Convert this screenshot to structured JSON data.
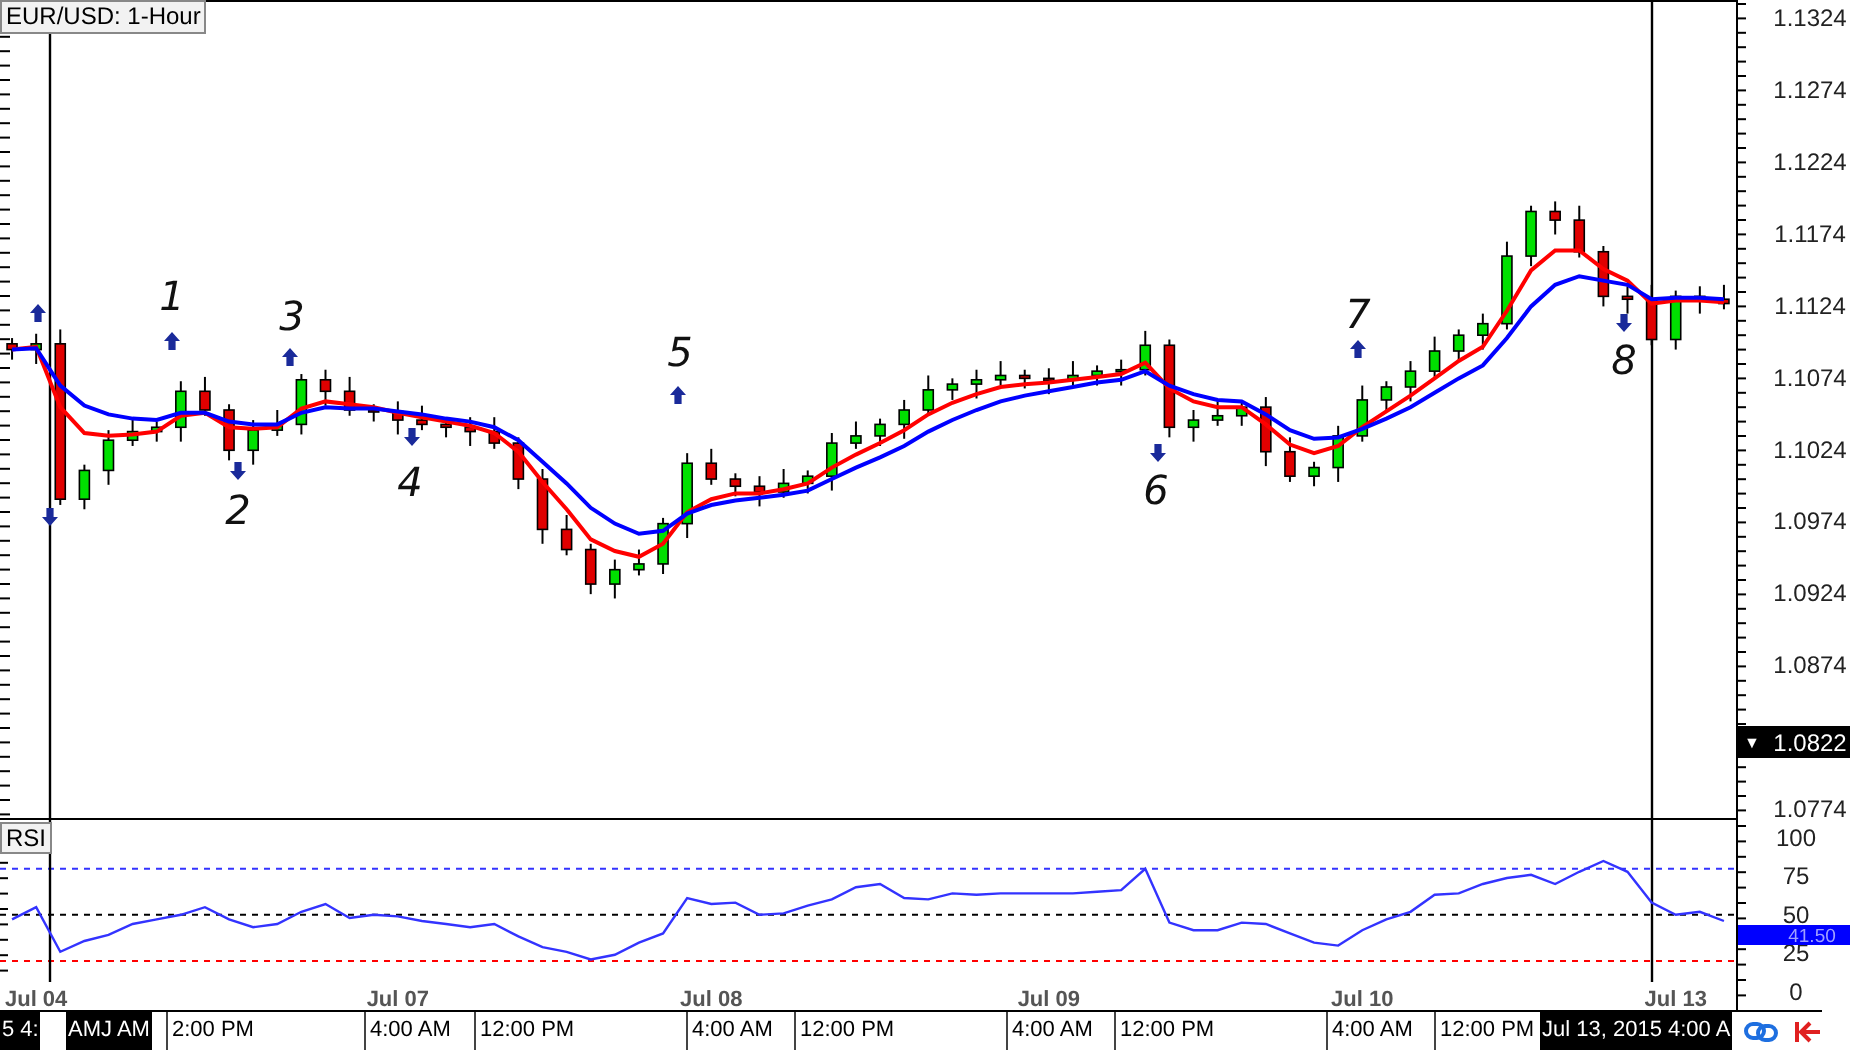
{
  "price_panel": {
    "chart_data": {
      "type": "candlestick",
      "title": "EUR/USD: 1-Hour",
      "ylim": [
        1.0768,
        1.1338
      ],
      "yticks": [
        1.1324,
        1.1274,
        1.1224,
        1.1174,
        1.1124,
        1.1074,
        1.1024,
        1.0974,
        1.0924,
        1.0874,
        1.0774
      ],
      "categories": [
        null,
        null,
        null,
        null,
        null,
        null,
        null,
        null,
        null,
        null,
        null,
        null,
        null,
        null,
        null,
        null,
        null,
        null,
        null,
        null,
        null,
        null,
        null,
        null,
        null,
        null,
        null,
        null,
        null,
        null,
        null,
        null,
        null,
        null,
        null,
        null,
        null,
        null,
        null,
        null,
        null,
        null,
        null,
        null,
        null,
        null,
        null,
        null,
        null,
        null,
        null,
        null,
        null,
        null,
        null,
        null,
        null,
        null,
        null,
        null,
        null,
        null,
        null,
        null,
        null,
        null,
        null,
        null,
        null,
        null,
        null,
        null
      ],
      "ohlc": [
        [
          1.1099,
          1.1103,
          1.1088,
          1.1095
        ],
        [
          1.1095,
          1.1106,
          1.1085,
          1.1099
        ],
        [
          1.1099,
          1.1109,
          1.0987,
          1.0991
        ],
        [
          1.0991,
          1.1015,
          1.0984,
          1.1011
        ],
        [
          1.1011,
          1.1039,
          1.1001,
          1.1032
        ],
        [
          1.1032,
          1.1048,
          1.1028,
          1.1038
        ],
        [
          1.1038,
          1.1045,
          1.1031,
          1.1041
        ],
        [
          1.1041,
          1.1073,
          1.1031,
          1.1066
        ],
        [
          1.1066,
          1.1076,
          1.1049,
          1.1053
        ],
        [
          1.1053,
          1.1057,
          1.1018,
          1.1025
        ],
        [
          1.1025,
          1.1046,
          1.1015,
          1.1039
        ],
        [
          1.1039,
          1.1053,
          1.1035,
          1.1043
        ],
        [
          1.1043,
          1.1078,
          1.1036,
          1.1074
        ],
        [
          1.1074,
          1.1081,
          1.1056,
          1.1066
        ],
        [
          1.1066,
          1.1076,
          1.1049,
          1.1053
        ],
        [
          1.1053,
          1.1057,
          1.1045,
          1.1052
        ],
        [
          1.1052,
          1.1059,
          1.1036,
          1.1046
        ],
        [
          1.1046,
          1.1056,
          1.1039,
          1.1043
        ],
        [
          1.1043,
          1.1047,
          1.1034,
          1.1041
        ],
        [
          1.1041,
          1.1048,
          1.1028,
          1.1038
        ],
        [
          1.1038,
          1.1048,
          1.1026,
          1.103
        ],
        [
          1.103,
          1.1034,
          1.0998,
          1.1005
        ],
        [
          1.1005,
          1.1012,
          1.096,
          1.097
        ],
        [
          1.097,
          1.098,
          1.0952,
          1.0956
        ],
        [
          1.0956,
          1.096,
          1.0925,
          1.0932
        ],
        [
          1.0932,
          1.0949,
          1.0922,
          1.0942
        ],
        [
          1.0942,
          1.0956,
          1.0938,
          1.0946
        ],
        [
          1.0946,
          1.0978,
          1.0939,
          1.0974
        ],
        [
          1.0974,
          1.1023,
          1.0964,
          1.1016
        ],
        [
          1.1016,
          1.1026,
          1.1001,
          1.1005
        ],
        [
          1.1005,
          1.1009,
          1.0993,
          1.1
        ],
        [
          1.1,
          1.1007,
          1.0986,
          1.0996
        ],
        [
          1.0996,
          1.1012,
          1.0992,
          1.1002
        ],
        [
          1.1002,
          1.1011,
          1.0995,
          1.1007
        ],
        [
          1.1007,
          1.1037,
          1.0997,
          1.103
        ],
        [
          1.103,
          1.1045,
          1.1026,
          1.1035
        ],
        [
          1.1035,
          1.1047,
          1.1028,
          1.1043
        ],
        [
          1.1043,
          1.106,
          1.1033,
          1.1053
        ],
        [
          1.1053,
          1.1077,
          1.1049,
          1.1067
        ],
        [
          1.1067,
          1.1075,
          1.106,
          1.1071
        ],
        [
          1.1071,
          1.1081,
          1.1061,
          1.1074
        ],
        [
          1.1074,
          1.1087,
          1.107,
          1.1077
        ],
        [
          1.1077,
          1.1081,
          1.1068,
          1.1075
        ],
        [
          1.1075,
          1.1082,
          1.1064,
          1.1074
        ],
        [
          1.1074,
          1.1087,
          1.107,
          1.1077
        ],
        [
          1.1077,
          1.1084,
          1.107,
          1.108
        ],
        [
          1.108,
          1.1088,
          1.107,
          1.1081
        ],
        [
          1.1081,
          1.1108,
          1.1077,
          1.1098
        ],
        [
          1.1098,
          1.1102,
          1.1034,
          1.1041
        ],
        [
          1.1041,
          1.1053,
          1.1031,
          1.1046
        ],
        [
          1.1046,
          1.1059,
          1.1042,
          1.1049
        ],
        [
          1.1049,
          1.1059,
          1.1042,
          1.1055
        ],
        [
          1.1055,
          1.1062,
          1.1014,
          1.1024
        ],
        [
          1.1024,
          1.1034,
          1.1003,
          1.1007
        ],
        [
          1.1007,
          1.1017,
          1.1,
          1.1013
        ],
        [
          1.1013,
          1.1042,
          1.1003,
          1.1035
        ],
        [
          1.1035,
          1.107,
          1.1031,
          1.106
        ],
        [
          1.106,
          1.1073,
          1.1053,
          1.1069
        ],
        [
          1.1069,
          1.1087,
          1.1059,
          1.108
        ],
        [
          1.108,
          1.1104,
          1.1076,
          1.1094
        ],
        [
          1.1094,
          1.1109,
          1.1087,
          1.1105
        ],
        [
          1.1105,
          1.112,
          1.1095,
          1.1113
        ],
        [
          1.1113,
          1.117,
          1.1109,
          1.116
        ],
        [
          1.116,
          1.1195,
          1.1153,
          1.1191
        ],
        [
          1.1191,
          1.1198,
          1.1175,
          1.1185
        ],
        [
          1.1185,
          1.1195,
          1.1159,
          1.1163
        ],
        [
          1.1163,
          1.1167,
          1.1125,
          1.1132
        ],
        [
          1.1132,
          1.1139,
          1.112,
          1.113
        ],
        [
          1.113,
          1.114,
          1.1098,
          1.1102
        ],
        [
          1.1102,
          1.1136,
          1.1095,
          1.1132
        ],
        [
          1.1132,
          1.1139,
          1.112,
          1.113
        ],
        [
          1.113,
          1.114,
          1.1123,
          1.1127
        ]
      ],
      "series": [
        {
          "type": "line",
          "color": "#ff0000",
          "values": [
            1.1095,
            1.1097,
            1.1055,
            1.1037,
            1.1035,
            1.1036,
            1.1038,
            1.1049,
            1.1051,
            1.1041,
            1.104,
            1.1041,
            1.1054,
            1.1059,
            1.1057,
            1.1055,
            1.1051,
            1.1048,
            1.1045,
            1.1042,
            1.1037,
            1.1024,
            1.1003,
            1.0984,
            1.0963,
            1.0955,
            1.0951,
            1.096,
            1.0982,
            1.0991,
            1.0995,
            1.0995,
            1.0998,
            1.1002,
            1.1013,
            1.1022,
            1.103,
            1.1039,
            1.105,
            1.1058,
            1.1064,
            1.1069,
            1.1071,
            1.1072,
            1.1074,
            1.1076,
            1.1078,
            1.1086,
            1.1068,
            1.1059,
            1.1055,
            1.1055,
            1.1043,
            1.1029,
            1.1023,
            1.1028,
            1.1041,
            1.1052,
            1.1063,
            1.1075,
            1.1087,
            1.1097,
            1.1122,
            1.115,
            1.1164,
            1.1164,
            1.1151,
            1.1143,
            1.1127,
            1.1129,
            1.1129,
            1.1128
          ]
        },
        {
          "type": "line",
          "color": "#0000ff",
          "values": [
            1.1095,
            1.1096,
            1.107,
            1.1056,
            1.105,
            1.1047,
            1.1046,
            1.1051,
            1.1051,
            1.1045,
            1.1043,
            1.1043,
            1.1051,
            1.1055,
            1.1054,
            1.1054,
            1.1052,
            1.105,
            1.1047,
            1.1045,
            1.1041,
            1.1032,
            1.1017,
            1.1002,
            1.0985,
            1.0974,
            1.0967,
            1.0969,
            1.0981,
            1.0987,
            1.099,
            1.0992,
            1.0994,
            1.0997,
            1.1005,
            1.1013,
            1.102,
            1.1028,
            1.1038,
            1.1046,
            1.1053,
            1.1059,
            1.1063,
            1.1066,
            1.1069,
            1.1072,
            1.1074,
            1.108,
            1.107,
            1.1064,
            1.106,
            1.1059,
            1.105,
            1.1039,
            1.1033,
            1.1034,
            1.104,
            1.1047,
            1.1055,
            1.1065,
            1.1075,
            1.1084,
            1.1103,
            1.1125,
            1.114,
            1.1146,
            1.1143,
            1.114,
            1.113,
            1.1131,
            1.1131,
            1.113
          ]
        }
      ],
      "annotations": [
        "1",
        "2",
        "3",
        "4",
        "5",
        "6",
        "7",
        "8"
      ]
    },
    "price_tag": {
      "marker": "▼",
      "text": "1.0822"
    }
  },
  "rsi_panel": {
    "chart_data": {
      "type": "line",
      "title": "RSI",
      "ylim": [
        -10.2,
        110.2
      ],
      "yticks": [
        100,
        75,
        50,
        25,
        0
      ],
      "categories": [
        null,
        "Jul 04",
        null,
        null,
        null,
        null,
        null,
        null,
        null,
        null,
        null,
        null,
        null,
        null,
        null,
        null,
        "Jul 07",
        null,
        null,
        null,
        null,
        null,
        null,
        null,
        null,
        null,
        null,
        null,
        null,
        "Jul 08",
        null,
        null,
        null,
        null,
        null,
        null,
        null,
        null,
        null,
        null,
        null,
        null,
        null,
        "Jul 09",
        null,
        null,
        null,
        null,
        null,
        null,
        null,
        null,
        null,
        null,
        null,
        null,
        "Jul 10",
        null,
        null,
        null,
        null,
        null,
        null,
        null,
        null,
        null,
        null,
        null,
        null,
        "Jul 13",
        null,
        null
      ],
      "series": [
        {
          "color": "#3333ff",
          "values": [
            47,
            55,
            26,
            33,
            37,
            44,
            47,
            50,
            55,
            47,
            42,
            44,
            52,
            57,
            48,
            50,
            49,
            46,
            44,
            42,
            44,
            36,
            29,
            26,
            21,
            24,
            32,
            38,
            61,
            57,
            58,
            50,
            51,
            56,
            60,
            68,
            70,
            61,
            60,
            64,
            63,
            64,
            64,
            64,
            64,
            65,
            66,
            80,
            45,
            40,
            40,
            45,
            44,
            38,
            32,
            30,
            40,
            47,
            52,
            63,
            64,
            70,
            74,
            76,
            70,
            78,
            85,
            78,
            58,
            50,
            52,
            46
          ]
        }
      ],
      "ref_lines": [
        {
          "axis": "y",
          "value": 80,
          "color": "#3333ff"
        },
        {
          "axis": "y",
          "value": 50,
          "color": "#000000"
        },
        {
          "axis": "y",
          "value": 20,
          "color": "#ff0000"
        }
      ]
    },
    "value_tag": {
      "text": "41.50"
    }
  },
  "time_bar": [
    {
      "text": "5 4:",
      "highlighted": true
    },
    {
      "text": "AMJ AM",
      "highlighted": true
    },
    {
      "text": "2:00 PM",
      "highlighted": false
    },
    {
      "text": "4:00 AM",
      "highlighted": false
    },
    {
      "text": "12:00 PM",
      "highlighted": false
    },
    {
      "text": "4:00 AM",
      "highlighted": false
    },
    {
      "text": "12:00 PM",
      "highlighted": false
    },
    {
      "text": "4:00 AM",
      "highlighted": false
    },
    {
      "text": "12:00 PM",
      "highlighted": false
    },
    {
      "text": "4:00 AM",
      "highlighted": false
    },
    {
      "text": "12:00 PM",
      "highlighted": false
    },
    {
      "text": "Jul 13, 2015 4:00 A",
      "highlighted": true
    }
  ]
}
